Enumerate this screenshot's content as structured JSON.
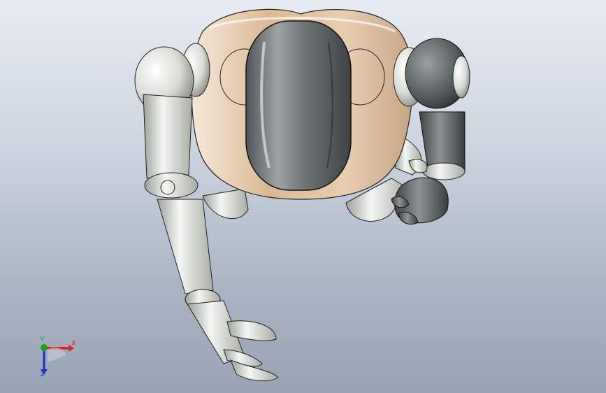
{
  "viewport": {
    "background_top": "#e8ecf2",
    "background_bottom": "#98a3b5"
  },
  "model": {
    "body_color": "#e2c6a6",
    "head_color": "#7a7f80",
    "limb_color": "#d8dcd6",
    "dark_limb_color": "#5f6466"
  },
  "triad": {
    "x_label": "X",
    "y_label": "Y",
    "z_label": "Z",
    "x_color": "#e02020",
    "y_color": "#20a020",
    "z_color": "#2030c0"
  }
}
